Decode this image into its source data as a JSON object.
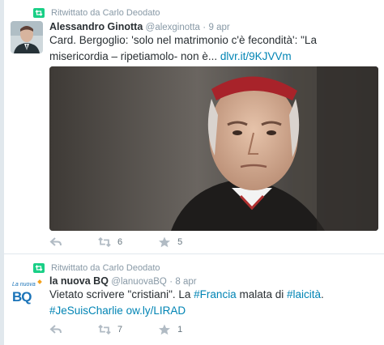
{
  "tweets": [
    {
      "context": "Ritwittato da Carlo Deodato",
      "fullname": "Alessandro Ginotta",
      "username": "@alexginotta",
      "dot": "·",
      "time": "9 apr",
      "text": "Card. Bergoglio: 'solo nel matrimonio c'è fecondità': \"La misericordia – ripetiamolo- non è... ",
      "link": "dlvr.it/9KJVVm",
      "retweets": "6",
      "favorites": "5"
    },
    {
      "context": "Ritwittato da Carlo Deodato",
      "fullname": "la nuova BQ",
      "username": "@lanuovaBQ",
      "dot": "·",
      "time": "8 apr",
      "text_a": "Vietato scrivere \"cristiani\". La ",
      "tag_francia": "#Francia",
      "text_b": " malata di ",
      "tag_laicita": "#laicità",
      "text_c": ".",
      "tag_charlie": "#JeSuisCharlie",
      "space": " ",
      "link": "ow.ly/LIRAD",
      "avatar_small": "La nuova",
      "avatar_big": "BQ",
      "retweets": "7",
      "favorites": "1"
    }
  ],
  "colors": {
    "link": "#0084b4",
    "retweet_badge": "#19cf86",
    "muted": "#8899a6"
  },
  "icons": [
    "retweet-context-icon",
    "reply-icon",
    "retweet-icon",
    "favorite-star-icon"
  ]
}
